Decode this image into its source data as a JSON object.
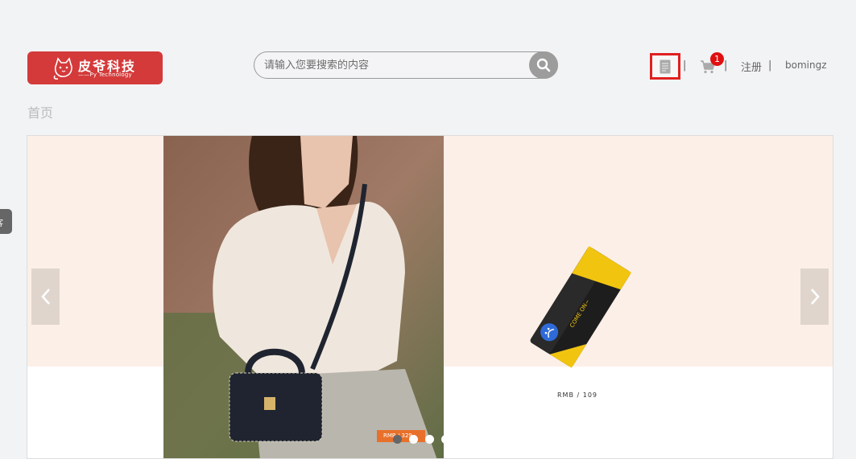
{
  "header": {
    "logo": {
      "title": "皮爷科技",
      "subtitle": "——Py Technology",
      "color": "#d43a3a"
    },
    "search": {
      "placeholder": "请输入您要搜索的内容"
    },
    "doc_icon": "document-icon",
    "cart": {
      "icon": "cart-icon",
      "count": "1"
    },
    "separator": "|",
    "register_label": "注册",
    "user_label": "bomingz"
  },
  "breadcrumb": {
    "home": "首页"
  },
  "side_tab": {
    "label": "客"
  },
  "carousel": {
    "prev_icon": "chevron-left-icon",
    "next_icon": "chevron-right-icon",
    "product_price": "RMB /  109",
    "photo_price": "RMB /  329",
    "slides": 4,
    "active_slide": 1
  },
  "colors": {
    "accent": "#d43a3a",
    "highlight_border": "#e02020",
    "badge": "#e01010",
    "band": "#fcefe7"
  }
}
